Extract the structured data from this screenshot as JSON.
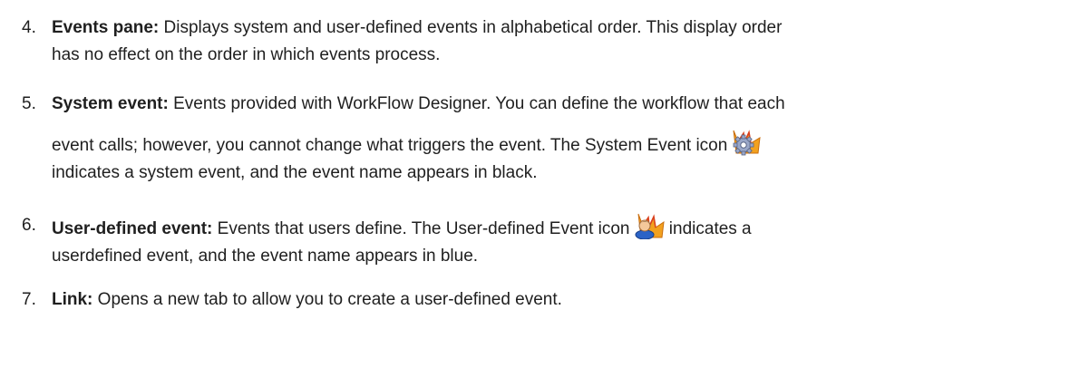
{
  "items": [
    {
      "number": "4.",
      "term": "Events pane:",
      "lines": [
        " Displays system and user-defined events in alphabetical order. This display order",
        "has no effect on the order in which events process."
      ]
    },
    {
      "number": "5.",
      "term": "System event:",
      "lines": [
        " Events provided with WorkFlow Designer. You can define the workflow that each",
        "event calls; however, you cannot change what triggers the event. The System Event icon",
        "indicates a system event, and the event name appears in black."
      ],
      "icon": "system-event-icon"
    },
    {
      "number": "6.",
      "term": "User-defined event:",
      "lines": [
        " Events that users define. The User-defined Event icon",
        " indicates a",
        "userdefined event, and the event name appears in blue."
      ],
      "icon": "user-defined-event-icon"
    },
    {
      "number": "7.",
      "term": "Link:",
      "lines": [
        " Opens a new tab to allow you to create a user-defined event."
      ]
    }
  ]
}
